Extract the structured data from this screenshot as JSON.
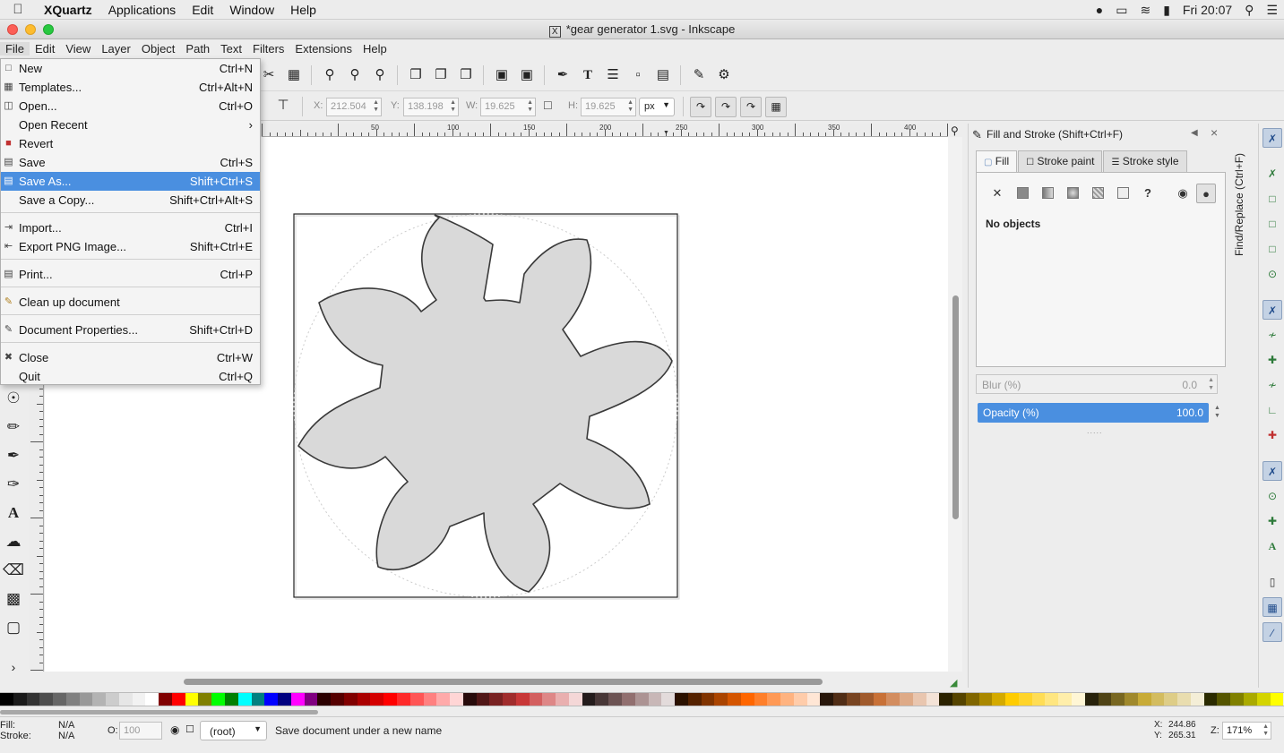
{
  "macbar": {
    "app_name": "XQuartz",
    "menus": [
      "Applications",
      "Edit",
      "Window",
      "Help"
    ],
    "clock": "Fri 20:07"
  },
  "window": {
    "title": "*gear generator 1.svg - Inkscape",
    "x_glyph": "X"
  },
  "app_menu": [
    "File",
    "Edit",
    "View",
    "Layer",
    "Object",
    "Path",
    "Text",
    "Filters",
    "Extensions",
    "Help"
  ],
  "file_menu": {
    "items": [
      {
        "label": "New",
        "accel": "Ctrl+N",
        "icon": "new-doc-icon"
      },
      {
        "label": "Templates...",
        "accel": "Ctrl+Alt+N",
        "icon": "templates-icon"
      },
      {
        "label": "Open...",
        "accel": "Ctrl+O",
        "icon": "open-folder-icon"
      },
      {
        "label": "Open Recent",
        "accel": "",
        "icon": "",
        "submenu_glyph": "›"
      },
      {
        "label": "Revert",
        "accel": "",
        "icon": "revert-icon"
      },
      {
        "label": "Save",
        "accel": "Ctrl+S",
        "icon": "save-icon"
      },
      {
        "label": "Save As...",
        "accel": "Shift+Ctrl+S",
        "icon": "save-as-icon"
      },
      {
        "label": "Save a Copy...",
        "accel": "Shift+Ctrl+Alt+S",
        "icon": ""
      },
      {
        "label": "Import...",
        "accel": "Ctrl+I",
        "icon": "import-icon"
      },
      {
        "label": "Export PNG Image...",
        "accel": "Shift+Ctrl+E",
        "icon": "export-icon"
      },
      {
        "label": "Print...",
        "accel": "Ctrl+P",
        "icon": "print-icon"
      },
      {
        "label": "Clean up document",
        "accel": "",
        "icon": "broom-icon"
      },
      {
        "label": "Document Properties...",
        "accel": "Shift+Ctrl+D",
        "icon": "document-properties-icon"
      },
      {
        "label": "Close",
        "accel": "Ctrl+W",
        "icon": "close-doc-icon"
      },
      {
        "label": "Quit",
        "accel": "Ctrl+Q",
        "icon": ""
      }
    ],
    "highlighted_index": 6
  },
  "controls": {
    "x_label": "X:",
    "x_value": "212.504",
    "y_label": "Y:",
    "y_value": "138.198",
    "w_label": "W:",
    "w_value": "19.625",
    "h_label": "H:",
    "h_value": "19.625",
    "unit": "px"
  },
  "ruler_labels": [
    "50",
    "100",
    "150",
    "200",
    "250",
    "300",
    "350",
    "400"
  ],
  "fill_stroke": {
    "title": "Fill and Stroke (Shift+Ctrl+F)",
    "tabs": [
      "Fill",
      "Stroke paint",
      "Stroke style"
    ],
    "no_objects": "No objects",
    "unset_glyph": "?",
    "close_glyph": "×",
    "blur_label": "Blur (%)",
    "blur_value": "0.0",
    "opacity_label": "Opacity (%)",
    "opacity_value": "100.0"
  },
  "find_replace_label": "Find/Replace (Ctrl+F)",
  "status": {
    "fill_label": "Fill:",
    "fill_value": "N/A",
    "stroke_label": "Stroke:",
    "stroke_value": "N/A",
    "opacity_label": "O:",
    "opacity_value": "100",
    "layer": "(root)",
    "message": "Save document under a new name",
    "cursor_x_label": "X:",
    "cursor_x": "244.86",
    "cursor_y_label": "Y:",
    "cursor_y": "265.31",
    "zoom_label": "Z:",
    "zoom": "171%"
  },
  "colors": {
    "accent": "#4a8fe0",
    "gear_fill": "#d9d9d9",
    "gear_stroke": "#3a3a3a"
  }
}
